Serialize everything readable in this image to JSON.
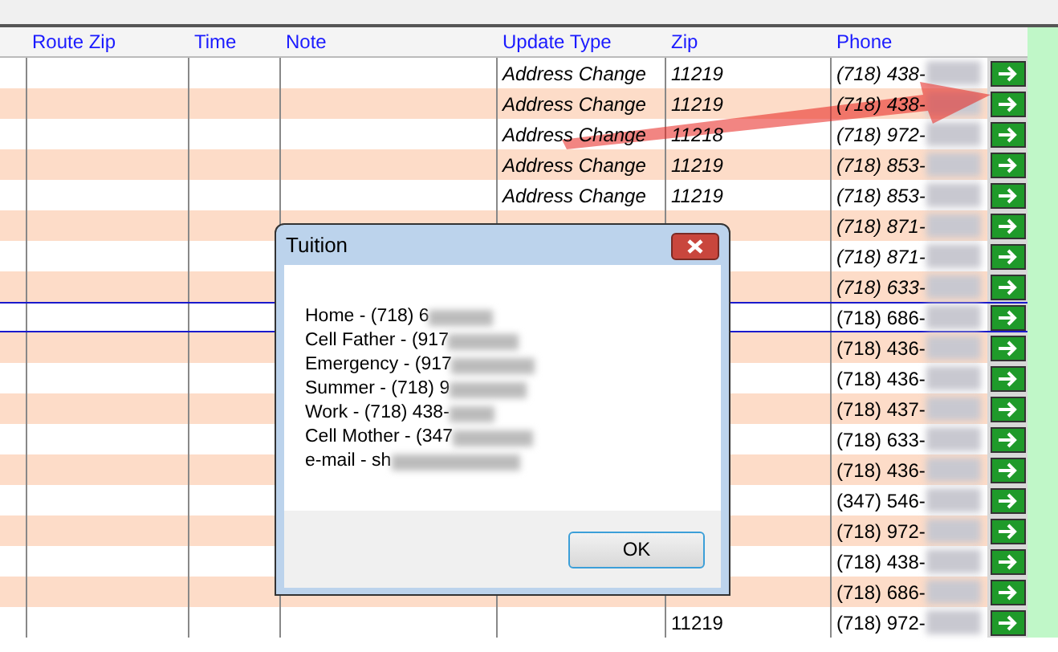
{
  "table": {
    "columns": [
      "Route Zip",
      "Time",
      "Note",
      "Update Type",
      "Zip",
      "Phone"
    ],
    "rows": [
      {
        "kind": "change",
        "selected": false,
        "update_type": "Address Change",
        "zip": "11219",
        "phone": "(718) 438-"
      },
      {
        "kind": "change",
        "selected": false,
        "update_type": "Address Change",
        "zip": "11219",
        "phone": "(718) 438-"
      },
      {
        "kind": "change",
        "selected": false,
        "update_type": "Address Change",
        "zip": "11218",
        "phone": "(718) 972-"
      },
      {
        "kind": "change",
        "selected": false,
        "update_type": "Address Change",
        "zip": "11219",
        "phone": "(718) 853-"
      },
      {
        "kind": "change",
        "selected": false,
        "update_type": "Address Change",
        "zip": "11219",
        "phone": "(718) 853-"
      },
      {
        "kind": "change",
        "selected": false,
        "phone": "(718) 871-"
      },
      {
        "kind": "change",
        "selected": false,
        "phone": "(718) 871-"
      },
      {
        "kind": "change",
        "selected": false,
        "phone": "(718) 633-"
      },
      {
        "kind": "plain",
        "selected": true,
        "phone": "(718) 686-"
      },
      {
        "kind": "plain",
        "selected": false,
        "phone": "(718) 436-"
      },
      {
        "kind": "plain",
        "selected": false,
        "phone": "(718) 436-"
      },
      {
        "kind": "plain",
        "selected": false,
        "phone": "(718) 437-"
      },
      {
        "kind": "plain",
        "selected": false,
        "phone": "(718) 633-"
      },
      {
        "kind": "plain",
        "selected": false,
        "phone": "(718) 436-"
      },
      {
        "kind": "plain",
        "selected": false,
        "phone": "(347) 546-"
      },
      {
        "kind": "plain",
        "selected": false,
        "phone": "(718) 972-"
      },
      {
        "kind": "plain",
        "selected": false,
        "phone": "(718) 438-"
      },
      {
        "kind": "plain",
        "selected": false,
        "phone": "(718) 686-"
      },
      {
        "kind": "plain",
        "selected": false,
        "zip": "11219",
        "phone": "(718) 972-"
      }
    ]
  },
  "dialog": {
    "title": "Tuition",
    "lines": [
      "Home - (718) 6",
      "Cell Father - (917",
      "Emergency - (917",
      "Summer - (718) 9",
      "Work - (718) 438-",
      "Cell Mother - (347",
      "e-mail - sh"
    ],
    "ok": "OK"
  }
}
